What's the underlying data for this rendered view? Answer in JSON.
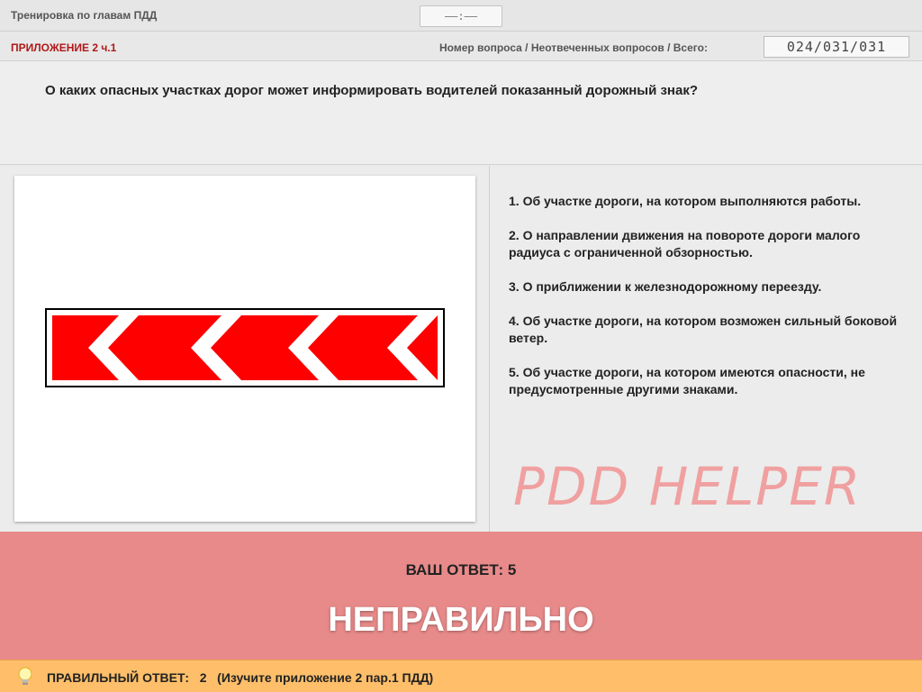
{
  "header": {
    "title": "Тренировка по главам ПДД",
    "timer": "––:––"
  },
  "info": {
    "section": "ПРИЛОЖЕНИЕ 2 ч.1",
    "counter_label": "Номер вопроса / Неотвеченных вопросов / Всего:",
    "counter_value": "024/031/031"
  },
  "question": {
    "text": "О каких опасных участках дорог может информировать водителей показанный дорожный знак?"
  },
  "answers": [
    "1.  Об участке дороги, на котором выполняются работы.",
    "2.  О направлении движения на повороте дороги малого радиуса с ограниченной обзорностью.",
    "3.  О приближении к железнодорожному переезду.",
    "4.  Об участке дороги, на котором возможен сильный боковой ветер.",
    "5.  Об участке дороги, на котором имеются опасности, не предусмотренные другими знаками."
  ],
  "watermark": "PDD HELPER",
  "result": {
    "your_answer": "ВАШ  ОТВЕТ:   5",
    "verdict": "НЕПРАВИЛЬНО"
  },
  "footer": {
    "correct_answer": "ПРАВИЛЬНЫЙ ОТВЕТ:   2   (Изучите приложение 2 пар.1 ПДД)"
  },
  "colors": {
    "section_red": "#b01818",
    "result_bg": "#e88a8a",
    "footer_bg": "#ffbf6a",
    "sign_red": "#ff0000"
  },
  "icons": {
    "bulb": "lightbulb-icon",
    "sign": "chevron-left-sign"
  }
}
